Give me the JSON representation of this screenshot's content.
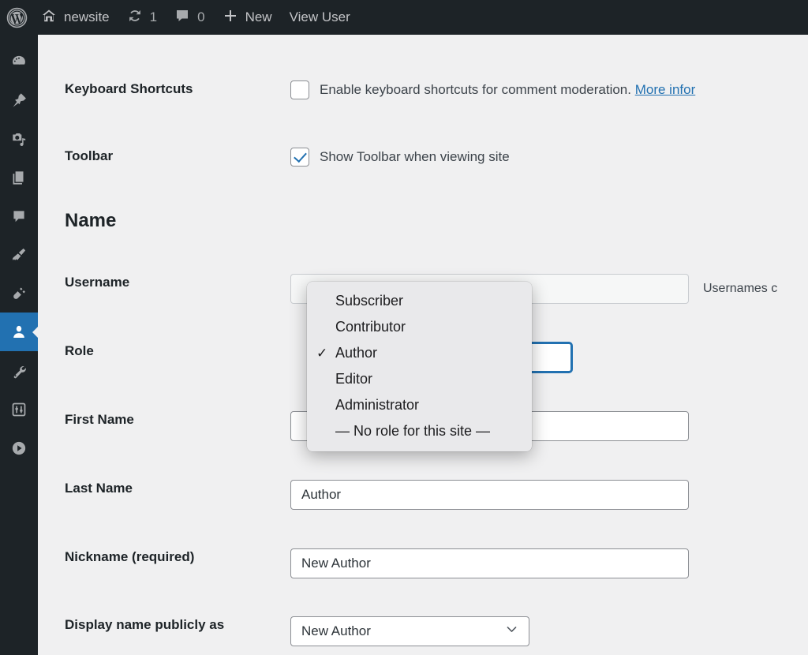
{
  "adminbar": {
    "logo_title": "About WordPress",
    "site_name": "newsite",
    "updates_count": "1",
    "comments_count": "0",
    "new_label": "New",
    "view_user_label": "View User"
  },
  "sidebar": {
    "items": [
      {
        "label": "Dashboard",
        "icon": "dashboard-icon",
        "current": false
      },
      {
        "label": "Posts",
        "icon": "pin-icon",
        "current": false
      },
      {
        "label": "Media",
        "icon": "media-icon",
        "current": false
      },
      {
        "label": "Pages",
        "icon": "pages-icon",
        "current": false
      },
      {
        "label": "Comments",
        "icon": "comment-icon",
        "current": false
      },
      {
        "label": "Appearance",
        "icon": "paintbrush-icon",
        "current": false
      },
      {
        "label": "Plugins",
        "icon": "plug-icon",
        "current": false
      },
      {
        "label": "Users",
        "icon": "user-icon",
        "current": true
      },
      {
        "label": "Tools",
        "icon": "wrench-icon",
        "current": false
      },
      {
        "label": "Settings",
        "icon": "sliders-icon",
        "current": false
      },
      {
        "label": "Collapse menu",
        "icon": "play-circle-icon",
        "current": false
      }
    ]
  },
  "form": {
    "keyboard_shortcuts": {
      "label": "Keyboard Shortcuts",
      "checkbox_text": "Enable keyboard shortcuts for comment moderation.",
      "link_text": "More infor",
      "checked": false
    },
    "toolbar": {
      "label": "Toolbar",
      "checkbox_text": "Show Toolbar when viewing site",
      "checked": true
    },
    "name_heading": "Name",
    "username": {
      "label": "Username",
      "value": "",
      "description": "Usernames c"
    },
    "role": {
      "label": "Role",
      "selected": "Author",
      "options": [
        {
          "label": "Subscriber",
          "selected": false
        },
        {
          "label": "Contributor",
          "selected": false
        },
        {
          "label": "Author",
          "selected": true
        },
        {
          "label": "Editor",
          "selected": false
        },
        {
          "label": "Administrator",
          "selected": false
        },
        {
          "label": "— No role for this site —",
          "selected": false
        }
      ],
      "check_glyph": "✓"
    },
    "first_name": {
      "label": "First Name",
      "value": ""
    },
    "last_name": {
      "label": "Last Name",
      "value": "Author"
    },
    "nickname": {
      "label": "Nickname (required)",
      "value": "New Author"
    },
    "display_name": {
      "label": "Display name publicly as",
      "value": "New Author",
      "chevron": "⌄"
    }
  },
  "colors": {
    "admin_dark": "#1d2327",
    "accent_blue": "#2271b1",
    "content_bg": "#f0f0f1",
    "dropdown_bg": "#e9e9eb"
  }
}
